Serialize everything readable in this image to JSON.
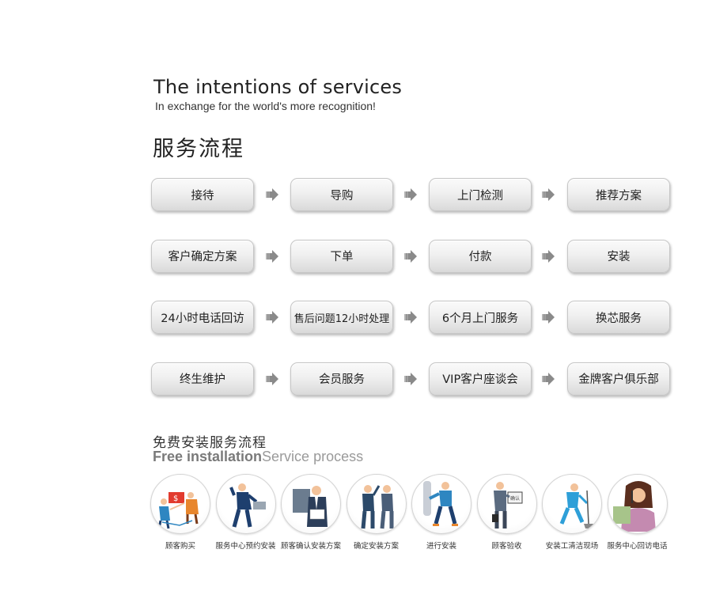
{
  "header": {
    "title_en": "The intentions of services",
    "subtitle_en": "In exchange for the world's more recognition!",
    "title_cn": "服务流程"
  },
  "flow": {
    "rows": [
      [
        "接待",
        "导购",
        "上门检测",
        "推荐方案"
      ],
      [
        "客户确定方案",
        "下单",
        "付款",
        "安装"
      ],
      [
        "24小时电话回访",
        "售后问题12小时处理",
        "6个月上门服务",
        "换芯服务"
      ],
      [
        "终生维护",
        "会员服务",
        "VIP客户座谈会",
        "金牌客户俱乐部"
      ]
    ],
    "arrow_icon": "double-chevron-right-icon"
  },
  "free_install": {
    "title_cn": "免费安装服务流程",
    "title_en_bold": "Free installation",
    "title_en_light": "Service process"
  },
  "process_icons": [
    {
      "label": "顾客购买",
      "icon": "customer-purchase-illustration"
    },
    {
      "label": "服务中心预约安装",
      "icon": "service-booking-illustration"
    },
    {
      "label": "顾客确认安装方案",
      "icon": "confirm-plan-illustration"
    },
    {
      "label": "确定安装方案",
      "icon": "determine-plan-illustration"
    },
    {
      "label": "进行安装",
      "icon": "installing-illustration"
    },
    {
      "label": "顾客验收",
      "icon": "inspection-illustration"
    },
    {
      "label": "安装工清洁现场",
      "icon": "cleaning-illustration"
    },
    {
      "label": "服务中心回访电话",
      "icon": "follow-up-call-illustration"
    }
  ],
  "colors": {
    "step_bg_top": "#fafafa",
    "step_bg_bottom": "#d9d9d9",
    "arrow": "#8a8a8a",
    "illustration_navy": "#1e3f6e",
    "illustration_blue": "#2e86c1",
    "illustration_orange": "#e8862d"
  }
}
